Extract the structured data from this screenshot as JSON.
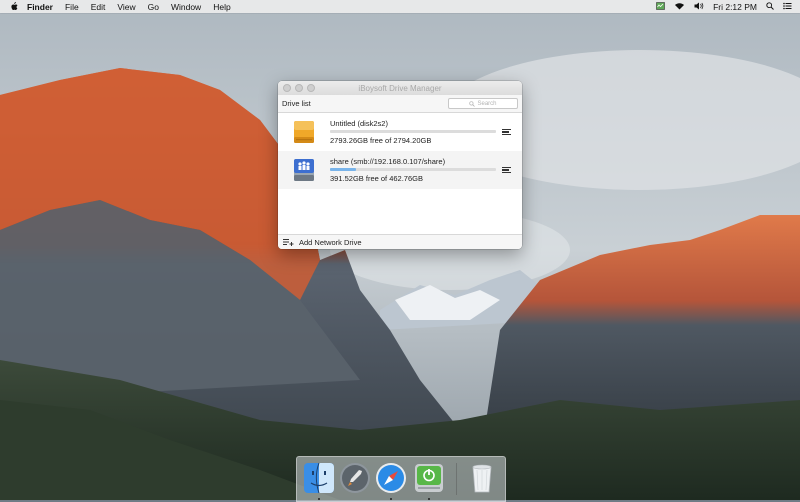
{
  "menubar": {
    "items": [
      "Finder",
      "File",
      "Edit",
      "View",
      "Go",
      "Window",
      "Help"
    ],
    "clock": "Fri 2:12 PM",
    "status_icons": [
      "activity-icon",
      "wifi-icon",
      "volume-icon",
      "spotlight-icon",
      "notification-center-icon"
    ]
  },
  "window": {
    "title": "iBoysoft Drive Manager",
    "list_label": "Drive list",
    "search_placeholder": "Search",
    "drives": [
      {
        "name": "Untitled (disk2s2)",
        "free_text": "2793.26GB free of 2794.20GB",
        "used_fraction": 0.0003,
        "icon": "external-drive-icon"
      },
      {
        "name": "share (smb://192.168.0.107/share)",
        "free_text": "391.52GB free of 462.76GB",
        "used_fraction": 0.154,
        "icon": "network-drive-icon"
      }
    ],
    "footer_label": "Add Network Drive"
  },
  "dock": {
    "apps": [
      "Finder",
      "Launchpad",
      "Safari",
      "iBoysoft Drive Manager"
    ],
    "trash": "Trash"
  },
  "colors": {
    "accent_bar": "#79b4ea",
    "drive_orange": "#f0a829",
    "network_blue": "#3d6fd0"
  }
}
